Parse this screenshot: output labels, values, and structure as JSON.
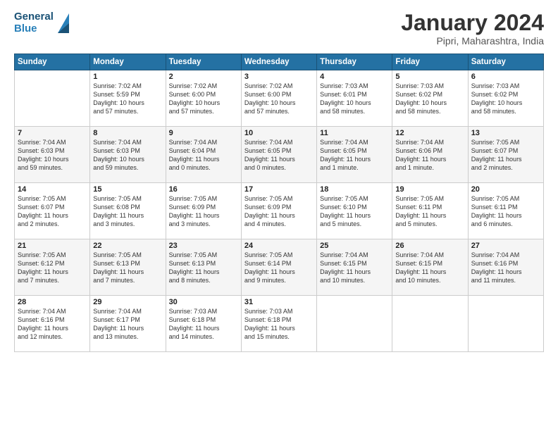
{
  "header": {
    "logo_line1": "General",
    "logo_line2": "Blue",
    "month": "January 2024",
    "location": "Pipri, Maharashtra, India"
  },
  "weekdays": [
    "Sunday",
    "Monday",
    "Tuesday",
    "Wednesday",
    "Thursday",
    "Friday",
    "Saturday"
  ],
  "weeks": [
    [
      {
        "day": "",
        "info": ""
      },
      {
        "day": "1",
        "info": "Sunrise: 7:02 AM\nSunset: 5:59 PM\nDaylight: 10 hours\nand 57 minutes."
      },
      {
        "day": "2",
        "info": "Sunrise: 7:02 AM\nSunset: 6:00 PM\nDaylight: 10 hours\nand 57 minutes."
      },
      {
        "day": "3",
        "info": "Sunrise: 7:02 AM\nSunset: 6:00 PM\nDaylight: 10 hours\nand 57 minutes."
      },
      {
        "day": "4",
        "info": "Sunrise: 7:03 AM\nSunset: 6:01 PM\nDaylight: 10 hours\nand 58 minutes."
      },
      {
        "day": "5",
        "info": "Sunrise: 7:03 AM\nSunset: 6:02 PM\nDaylight: 10 hours\nand 58 minutes."
      },
      {
        "day": "6",
        "info": "Sunrise: 7:03 AM\nSunset: 6:02 PM\nDaylight: 10 hours\nand 58 minutes."
      }
    ],
    [
      {
        "day": "7",
        "info": "Sunrise: 7:04 AM\nSunset: 6:03 PM\nDaylight: 10 hours\nand 59 minutes."
      },
      {
        "day": "8",
        "info": "Sunrise: 7:04 AM\nSunset: 6:03 PM\nDaylight: 10 hours\nand 59 minutes."
      },
      {
        "day": "9",
        "info": "Sunrise: 7:04 AM\nSunset: 6:04 PM\nDaylight: 11 hours\nand 0 minutes."
      },
      {
        "day": "10",
        "info": "Sunrise: 7:04 AM\nSunset: 6:05 PM\nDaylight: 11 hours\nand 0 minutes."
      },
      {
        "day": "11",
        "info": "Sunrise: 7:04 AM\nSunset: 6:05 PM\nDaylight: 11 hours\nand 1 minute."
      },
      {
        "day": "12",
        "info": "Sunrise: 7:04 AM\nSunset: 6:06 PM\nDaylight: 11 hours\nand 1 minute."
      },
      {
        "day": "13",
        "info": "Sunrise: 7:05 AM\nSunset: 6:07 PM\nDaylight: 11 hours\nand 2 minutes."
      }
    ],
    [
      {
        "day": "14",
        "info": "Sunrise: 7:05 AM\nSunset: 6:07 PM\nDaylight: 11 hours\nand 2 minutes."
      },
      {
        "day": "15",
        "info": "Sunrise: 7:05 AM\nSunset: 6:08 PM\nDaylight: 11 hours\nand 3 minutes."
      },
      {
        "day": "16",
        "info": "Sunrise: 7:05 AM\nSunset: 6:09 PM\nDaylight: 11 hours\nand 3 minutes."
      },
      {
        "day": "17",
        "info": "Sunrise: 7:05 AM\nSunset: 6:09 PM\nDaylight: 11 hours\nand 4 minutes."
      },
      {
        "day": "18",
        "info": "Sunrise: 7:05 AM\nSunset: 6:10 PM\nDaylight: 11 hours\nand 5 minutes."
      },
      {
        "day": "19",
        "info": "Sunrise: 7:05 AM\nSunset: 6:11 PM\nDaylight: 11 hours\nand 5 minutes."
      },
      {
        "day": "20",
        "info": "Sunrise: 7:05 AM\nSunset: 6:11 PM\nDaylight: 11 hours\nand 6 minutes."
      }
    ],
    [
      {
        "day": "21",
        "info": "Sunrise: 7:05 AM\nSunset: 6:12 PM\nDaylight: 11 hours\nand 7 minutes."
      },
      {
        "day": "22",
        "info": "Sunrise: 7:05 AM\nSunset: 6:13 PM\nDaylight: 11 hours\nand 7 minutes."
      },
      {
        "day": "23",
        "info": "Sunrise: 7:05 AM\nSunset: 6:13 PM\nDaylight: 11 hours\nand 8 minutes."
      },
      {
        "day": "24",
        "info": "Sunrise: 7:05 AM\nSunset: 6:14 PM\nDaylight: 11 hours\nand 9 minutes."
      },
      {
        "day": "25",
        "info": "Sunrise: 7:04 AM\nSunset: 6:15 PM\nDaylight: 11 hours\nand 10 minutes."
      },
      {
        "day": "26",
        "info": "Sunrise: 7:04 AM\nSunset: 6:15 PM\nDaylight: 11 hours\nand 10 minutes."
      },
      {
        "day": "27",
        "info": "Sunrise: 7:04 AM\nSunset: 6:16 PM\nDaylight: 11 hours\nand 11 minutes."
      }
    ],
    [
      {
        "day": "28",
        "info": "Sunrise: 7:04 AM\nSunset: 6:16 PM\nDaylight: 11 hours\nand 12 minutes."
      },
      {
        "day": "29",
        "info": "Sunrise: 7:04 AM\nSunset: 6:17 PM\nDaylight: 11 hours\nand 13 minutes."
      },
      {
        "day": "30",
        "info": "Sunrise: 7:03 AM\nSunset: 6:18 PM\nDaylight: 11 hours\nand 14 minutes."
      },
      {
        "day": "31",
        "info": "Sunrise: 7:03 AM\nSunset: 6:18 PM\nDaylight: 11 hours\nand 15 minutes."
      },
      {
        "day": "",
        "info": ""
      },
      {
        "day": "",
        "info": ""
      },
      {
        "day": "",
        "info": ""
      }
    ]
  ]
}
